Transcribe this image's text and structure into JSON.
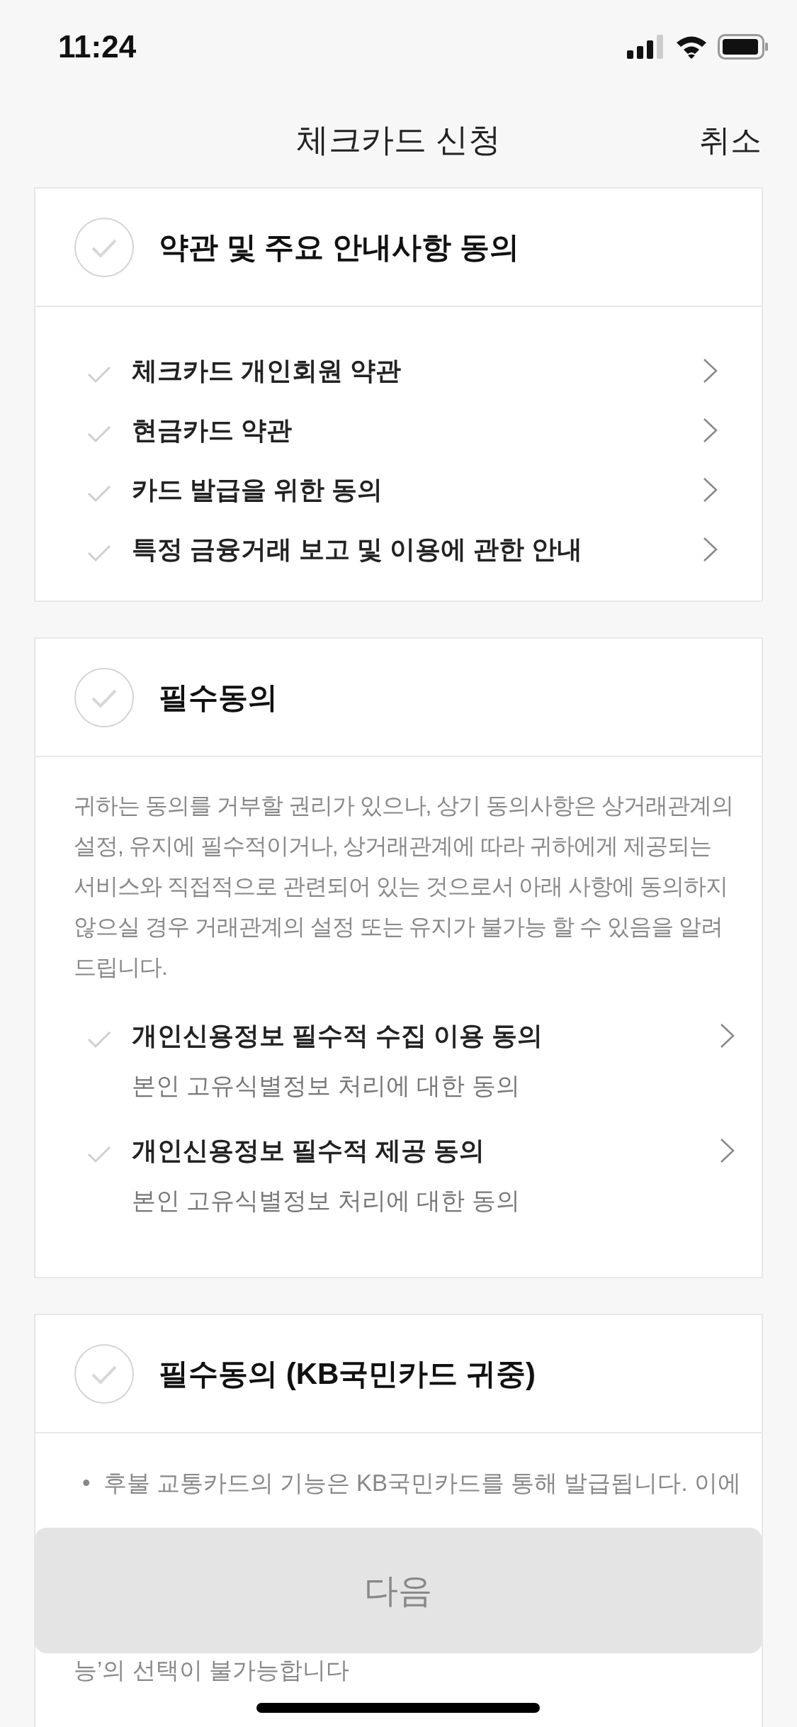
{
  "status_bar": {
    "time": "11:24"
  },
  "nav": {
    "title": "체크카드 신청",
    "cancel": "취소"
  },
  "sections": [
    {
      "title": "약관 및 주요 안내사항 동의",
      "checked": false,
      "items": [
        {
          "title": "체크카드 개인회원 약관",
          "checked": false
        },
        {
          "title": "현금카드 약관",
          "checked": false
        },
        {
          "title": "카드 발급을 위한 동의",
          "checked": false
        },
        {
          "title": "특정 금융거래 보고 및 이용에 관한 안내",
          "checked": false
        }
      ]
    },
    {
      "title": "필수동의",
      "checked": false,
      "description": "귀하는 동의를 거부할 권리가 있으나, 상기 동의사항은 상거래관계의 설정, 유지에 필수적이거나, 상거래관계에 따라 귀하에게 제공되는 서비스와 직접적으로 관련되어 있는 것으로서 아래 사항에 동의하지 않으실 경우 거래관계의 설정 또는 유지가 불가능 할 수 있음을 알려드립니다.",
      "items": [
        {
          "title": "개인신용정보 필수적 수집 이용 동의",
          "subtitle": "본인 고유식별정보 처리에 대한 동의",
          "checked": false
        },
        {
          "title": "개인신용정보 필수적 제공 동의",
          "subtitle": "본인 고유식별정보 처리에 대한 동의",
          "checked": false
        }
      ]
    },
    {
      "title": "필수동의 (KB국민카드 귀중)",
      "checked": false,
      "notice": {
        "bullet": "•",
        "first_line": "후불 교통카드의 기능은 KB국민카드를 통해 발급됩니다. 이에",
        "last_line": "능’의 선택이 불가능합니다"
      }
    }
  ],
  "next_button": {
    "label": "다음",
    "disabled": true
  }
}
